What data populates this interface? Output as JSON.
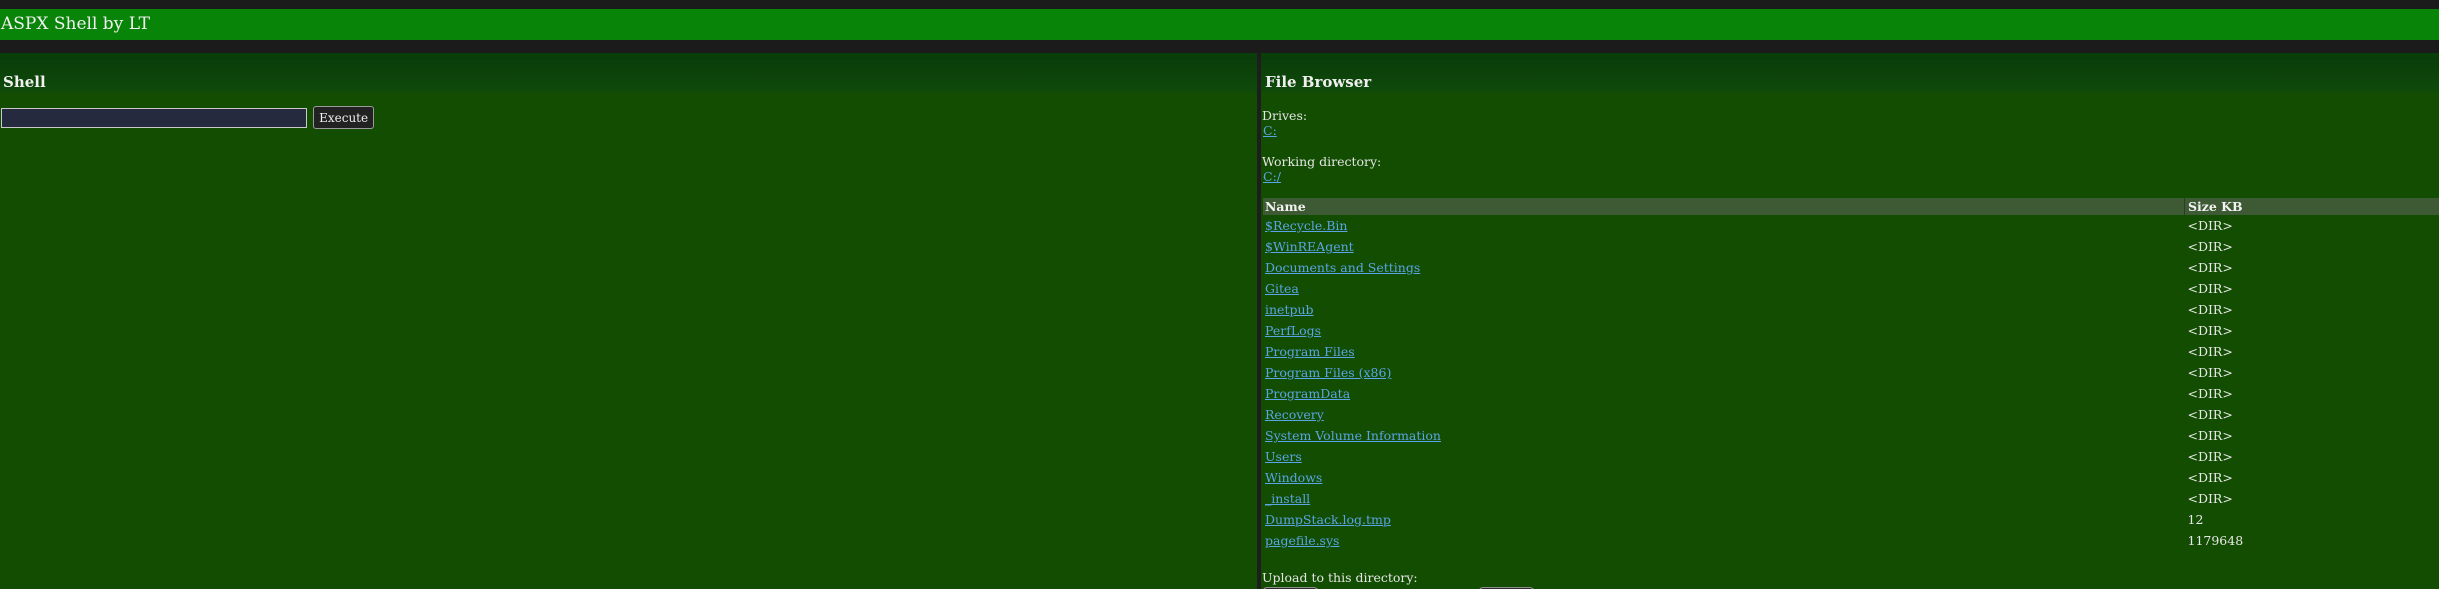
{
  "app_title": "ASPX Shell by LT",
  "shell": {
    "heading": "Shell",
    "command_value": "",
    "execute_label": "Execute"
  },
  "browser": {
    "heading": "File Browser",
    "drives_label": "Drives:",
    "drives": [
      "C:"
    ],
    "working_dir_label": "Working directory:",
    "working_dir": "C:/",
    "columns": [
      "Name",
      "Size KB"
    ],
    "rows": [
      {
        "name": "$Recycle.Bin",
        "size": "<DIR>"
      },
      {
        "name": "$WinREAgent",
        "size": "<DIR>"
      },
      {
        "name": "Documents and Settings",
        "size": "<DIR>"
      },
      {
        "name": "Gitea",
        "size": "<DIR>"
      },
      {
        "name": "inetpub",
        "size": "<DIR>"
      },
      {
        "name": "PerfLogs",
        "size": "<DIR>"
      },
      {
        "name": "Program Files",
        "size": "<DIR>"
      },
      {
        "name": "Program Files (x86)",
        "size": "<DIR>"
      },
      {
        "name": "ProgramData",
        "size": "<DIR>"
      },
      {
        "name": "Recovery",
        "size": "<DIR>"
      },
      {
        "name": "System Volume Information",
        "size": "<DIR>"
      },
      {
        "name": "Users",
        "size": "<DIR>"
      },
      {
        "name": "Windows",
        "size": "<DIR>"
      },
      {
        "name": "_install",
        "size": "<DIR>"
      },
      {
        "name": "DumpStack.log.tmp",
        "size": "12"
      },
      {
        "name": "pagefile.sys",
        "size": "1179648"
      }
    ],
    "upload_label": "Upload to this directory:"
  },
  "colors": {
    "title_bar": "#088508",
    "panel_bg": "#124d02",
    "link": "#5ba4e5",
    "table_header": "#3d5a35"
  }
}
